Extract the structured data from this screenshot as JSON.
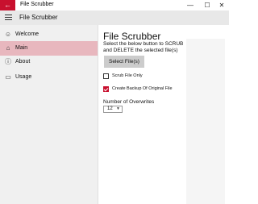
{
  "window": {
    "title": "File Scrubber",
    "back_symbol": "←",
    "minimize_symbol": "—",
    "maximize_symbol": "☐",
    "close_symbol": "✕"
  },
  "header": {
    "app_name": "File Scrubber"
  },
  "sidebar": {
    "items": [
      {
        "label": "Welcome",
        "icon": "smiley-icon",
        "glyph": "☺",
        "active": false
      },
      {
        "label": "Main",
        "icon": "home-icon",
        "glyph": "⌂",
        "active": true
      },
      {
        "label": "About",
        "icon": "info-icon",
        "glyph": "ⓘ",
        "active": false
      },
      {
        "label": "Usage",
        "icon": "book-icon",
        "glyph": "▭",
        "active": false
      }
    ]
  },
  "main": {
    "title": "File Scrubber",
    "description": "Select the below button to SCRUB and DELETE the selected file(s)",
    "select_button": "Select File(s)",
    "scrub_only": {
      "label": "Scrub File Only",
      "checked": false
    },
    "create_backup": {
      "label": "Create Backup Of Original File",
      "checked": true
    },
    "overwrites_label": "Number of Overwrites",
    "overwrites_value": "12"
  },
  "colors": {
    "accent": "#c8102e",
    "nav_active": "#e8b7be"
  }
}
